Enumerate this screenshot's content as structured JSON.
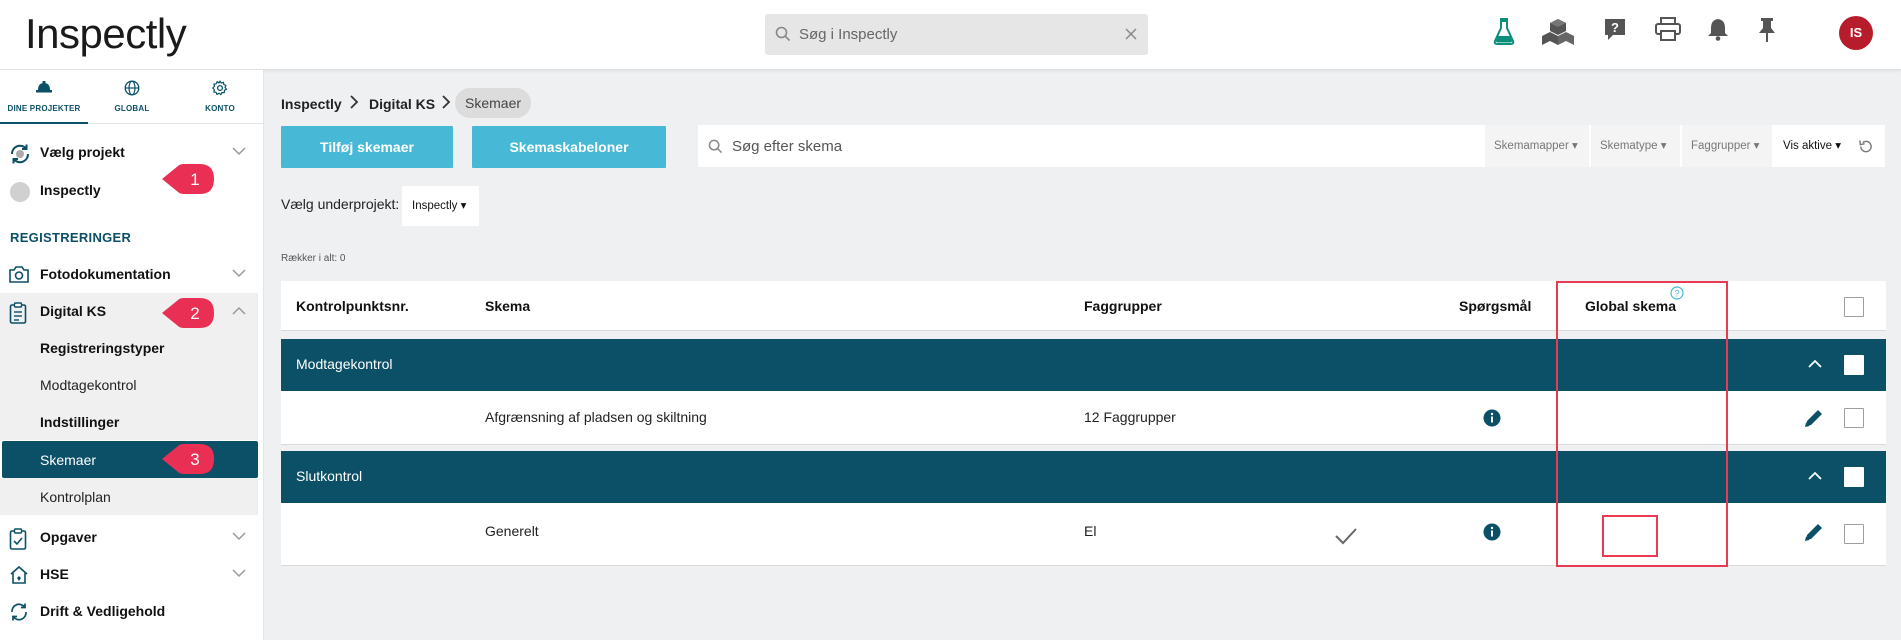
{
  "app": {
    "logo_text": "Inspectly",
    "search_placeholder": "Søg i Inspectly",
    "avatar_initials": "IS"
  },
  "top_icons": [
    "flask-icon",
    "cubes-icon",
    "help-chat-icon",
    "printer-icon",
    "bell-icon",
    "pin-icon"
  ],
  "sidebar": {
    "tabs": [
      {
        "label": "DINE PROJEKTER",
        "icon": "hardhat-icon",
        "active": true
      },
      {
        "label": "GLOBAL",
        "icon": "globe-icon",
        "active": false
      },
      {
        "label": "KONTO",
        "icon": "gear-icon",
        "active": false
      }
    ],
    "select_project": "Vælg projekt",
    "current_project": "Inspectly",
    "section_header": "REGISTRERINGER",
    "items": {
      "foto": "Fotodokumentation",
      "digital_ks": "Digital KS",
      "registreringstyper": "Registreringstyper",
      "modtagekontrol": "Modtagekontrol",
      "indstillinger": "Indstillinger",
      "skemaer": "Skemaer",
      "kontrolplan": "Kontrolplan",
      "opgaver": "Opgaver",
      "hse": "HSE",
      "drift": "Drift & Vedligehold"
    },
    "badges": [
      "1",
      "2",
      "3"
    ]
  },
  "breadcrumb": [
    "Inspectly",
    "Digital KS",
    "Skemaer"
  ],
  "buttons": {
    "add_schema": "Tilføj skemaer",
    "templates": "Skemaskabeloner"
  },
  "filters": {
    "search_placeholder": "Søg efter skema",
    "folders": "Skemamapper",
    "type": "Skematype",
    "trade_groups": "Faggrupper",
    "show": "Vis aktive"
  },
  "subproject": {
    "label": "Vælg underprojekt:",
    "value": "Inspectly"
  },
  "rows_total": "Rækker i alt: 0",
  "table": {
    "headers": {
      "control_nr": "Kontrolpunktsnr.",
      "schema": "Skema",
      "trade_groups": "Faggrupper",
      "questions": "Spørgsmål",
      "global": "Global skema"
    },
    "groups": [
      {
        "name": "Modtagekontrol",
        "rows": [
          {
            "control_nr": "",
            "schema": "Afgrænsning af pladsen og skiltning",
            "trade_groups": "12 Faggrupper",
            "global": false
          }
        ]
      },
      {
        "name": "Slutkontrol",
        "rows": [
          {
            "control_nr": "",
            "schema": "Generelt",
            "trade_groups": "El",
            "global": true
          }
        ]
      }
    ]
  },
  "colors": {
    "primary": "#0b5067",
    "button": "#47b9d6",
    "annotation": "#e83a52",
    "avatar": "#b71c2b"
  }
}
